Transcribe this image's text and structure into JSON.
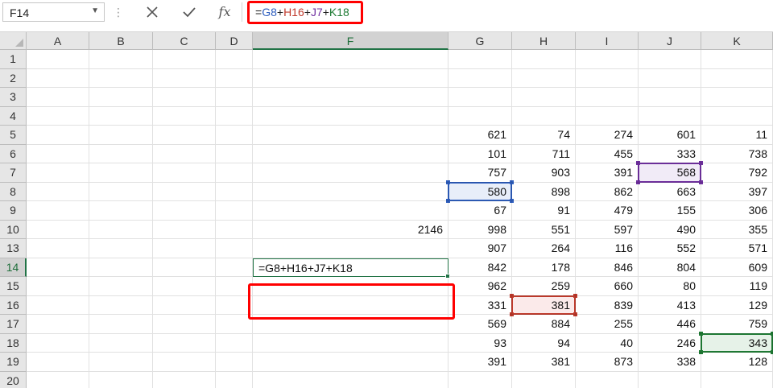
{
  "name_box": {
    "value": "F14"
  },
  "formula_bar": {
    "cancel_icon": "close-icon",
    "enter_icon": "check-icon",
    "fx_label": "fx",
    "formula_parts": [
      {
        "text": "=",
        "color": "#1f1f1f"
      },
      {
        "text": "G8",
        "color": "#2f5fbf"
      },
      {
        "text": "+",
        "color": "#1f1f1f"
      },
      {
        "text": "H16",
        "color": "#c0392b"
      },
      {
        "text": "+",
        "color": "#1f1f1f"
      },
      {
        "text": "J7",
        "color": "#7030a0"
      },
      {
        "text": "+",
        "color": "#1f1f1f"
      },
      {
        "text": "K18",
        "color": "#1e7b34"
      }
    ]
  },
  "columns": [
    "A",
    "B",
    "C",
    "D",
    "F",
    "G",
    "H",
    "I",
    "J",
    "K"
  ],
  "selected_column": "F",
  "rows": [
    "1",
    "2",
    "3",
    "4",
    "5",
    "6",
    "7",
    "8",
    "9",
    "10",
    "13",
    "14",
    "15",
    "16",
    "17",
    "18",
    "19",
    "20"
  ],
  "selected_row": "14",
  "cells": {
    "F10": "2146",
    "F14": "=G8+H16+J7+K18",
    "G5": "621",
    "H5": "74",
    "I5": "274",
    "J5": "601",
    "K5": "11",
    "G6": "101",
    "H6": "711",
    "I6": "455",
    "J6": "333",
    "K6": "738",
    "G7": "757",
    "H7": "903",
    "I7": "391",
    "J7": "568",
    "K7": "792",
    "G8": "580",
    "H8": "898",
    "I8": "862",
    "J8": "663",
    "K8": "397",
    "G9": "67",
    "H9": "91",
    "I9": "479",
    "J9": "155",
    "K9": "306",
    "G10": "998",
    "H10": "551",
    "I10": "597",
    "J10": "490",
    "K10": "355",
    "G13": "907",
    "H13": "264",
    "I13": "116",
    "J13": "552",
    "K13": "571",
    "G14": "842",
    "H14": "178",
    "I14": "846",
    "J14": "804",
    "K14": "609",
    "G15": "962",
    "H15": "259",
    "I15": "660",
    "J15": "80",
    "K15": "119",
    "G16": "331",
    "H16": "381",
    "I16": "839",
    "J16": "413",
    "K16": "129",
    "G17": "569",
    "H17": "884",
    "I17": "255",
    "J17": "446",
    "K17": "759",
    "G18": "93",
    "H18": "94",
    "I18": "40",
    "J18": "246",
    "K18": "343",
    "G19": "391",
    "H19": "381",
    "I19": "873",
    "J19": "338",
    "K19": "128"
  },
  "references": [
    {
      "cell": "G8",
      "color": "#2f5fbf",
      "fill": "#e8eef9"
    },
    {
      "cell": "H16",
      "color": "#c0392b",
      "fill": "#fbeaea"
    },
    {
      "cell": "J7",
      "color": "#7030a0",
      "fill": "#f1ebf7"
    },
    {
      "cell": "K18",
      "color": "#1e7b34",
      "fill": "#e6f2e8"
    }
  ],
  "accent_color": "#217346"
}
